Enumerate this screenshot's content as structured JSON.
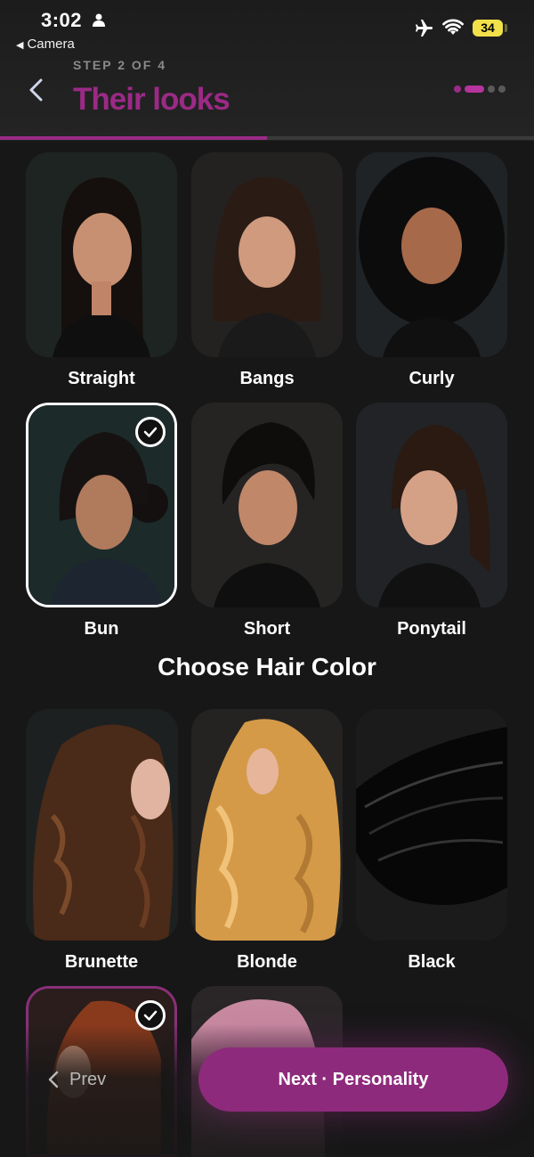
{
  "status_bar": {
    "time": "3:02",
    "back_app": "Camera",
    "battery": "34"
  },
  "header": {
    "step": "STEP 2 OF 4",
    "title": "Their looks",
    "progress": 0.5,
    "total_steps": 4,
    "current_step": 2
  },
  "styles": [
    {
      "label": "Straight",
      "selected": false
    },
    {
      "label": "Bangs",
      "selected": false
    },
    {
      "label": "Curly",
      "selected": false
    },
    {
      "label": "Bun",
      "selected": true
    },
    {
      "label": "Short",
      "selected": false
    },
    {
      "label": "Ponytail",
      "selected": false
    }
  ],
  "color_section": {
    "title": "Choose Hair Color"
  },
  "colors": [
    {
      "label": "Brunette",
      "selected": false
    },
    {
      "label": "Blonde",
      "selected": false
    },
    {
      "label": "Black",
      "selected": false
    },
    {
      "label": "",
      "selected": true
    },
    {
      "label": "",
      "selected": false
    }
  ],
  "nav": {
    "prev_label": "Prev",
    "next_label": "Next · Personality"
  },
  "colors_theme": {
    "accent": "#9b2a86",
    "button": "#8e2a7c",
    "background": "#171717"
  }
}
